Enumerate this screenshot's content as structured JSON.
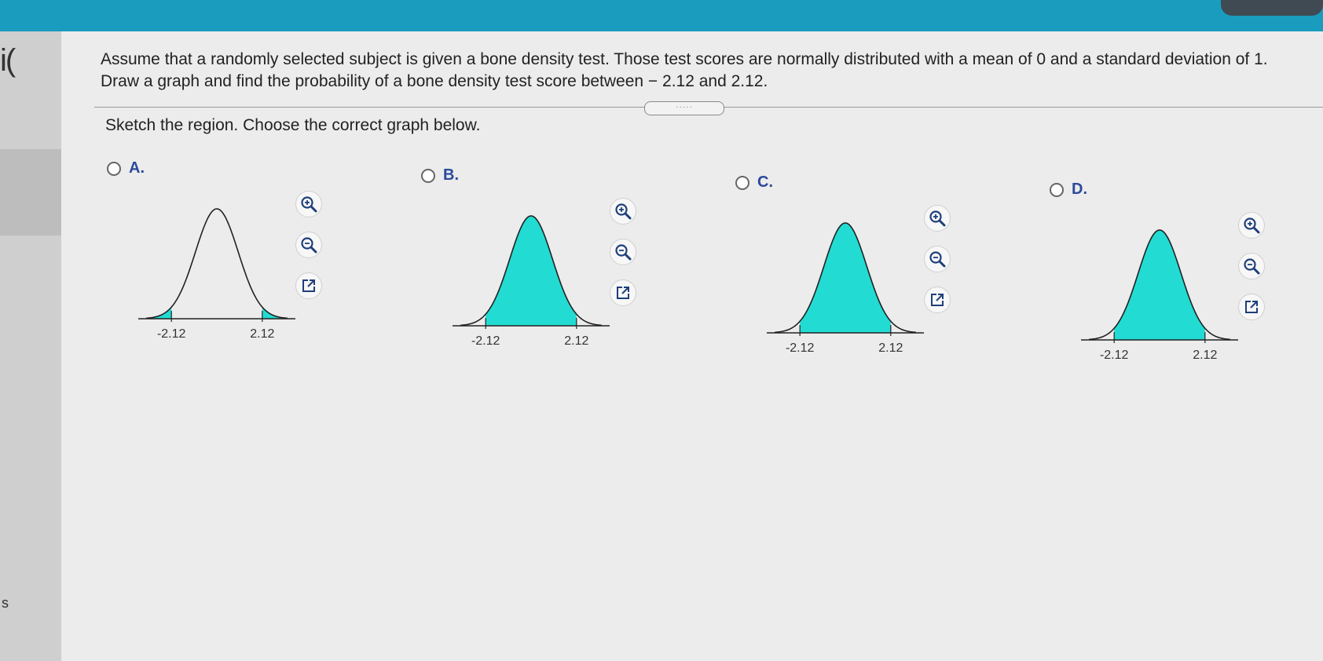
{
  "question": {
    "line1": "Assume that a randomly selected subject is given a bone density test. Those test scores are normally distributed with a mean of 0 and a standard deviation of 1.",
    "line2": "Draw a graph and find the probability of a bone density test score between − 2.12 and 2.12."
  },
  "handle_label": "·····",
  "instruction": "Sketch the region. Choose the correct graph below.",
  "left_edge": {
    "glyph": "i(",
    "bottom_glyph": "s"
  },
  "colors": {
    "shade": "#22dcd3",
    "topbar": "#1a9cbf",
    "option_letter": "#2b4a9a"
  },
  "options": [
    {
      "letter": "A.",
      "shading": "tails",
      "ticks": [
        "-2.12",
        "2.12"
      ]
    },
    {
      "letter": "B.",
      "shading": "between",
      "ticks": [
        "-2.12",
        "2.12"
      ]
    },
    {
      "letter": "C.",
      "shading": "between",
      "ticks": [
        "-2.12",
        "2.12"
      ]
    },
    {
      "letter": "D.",
      "shading": "between",
      "ticks": [
        "-2.12",
        "2.12"
      ]
    }
  ],
  "tools": [
    "zoom-in-icon",
    "zoom-out-icon",
    "open-new-window-icon"
  ]
}
